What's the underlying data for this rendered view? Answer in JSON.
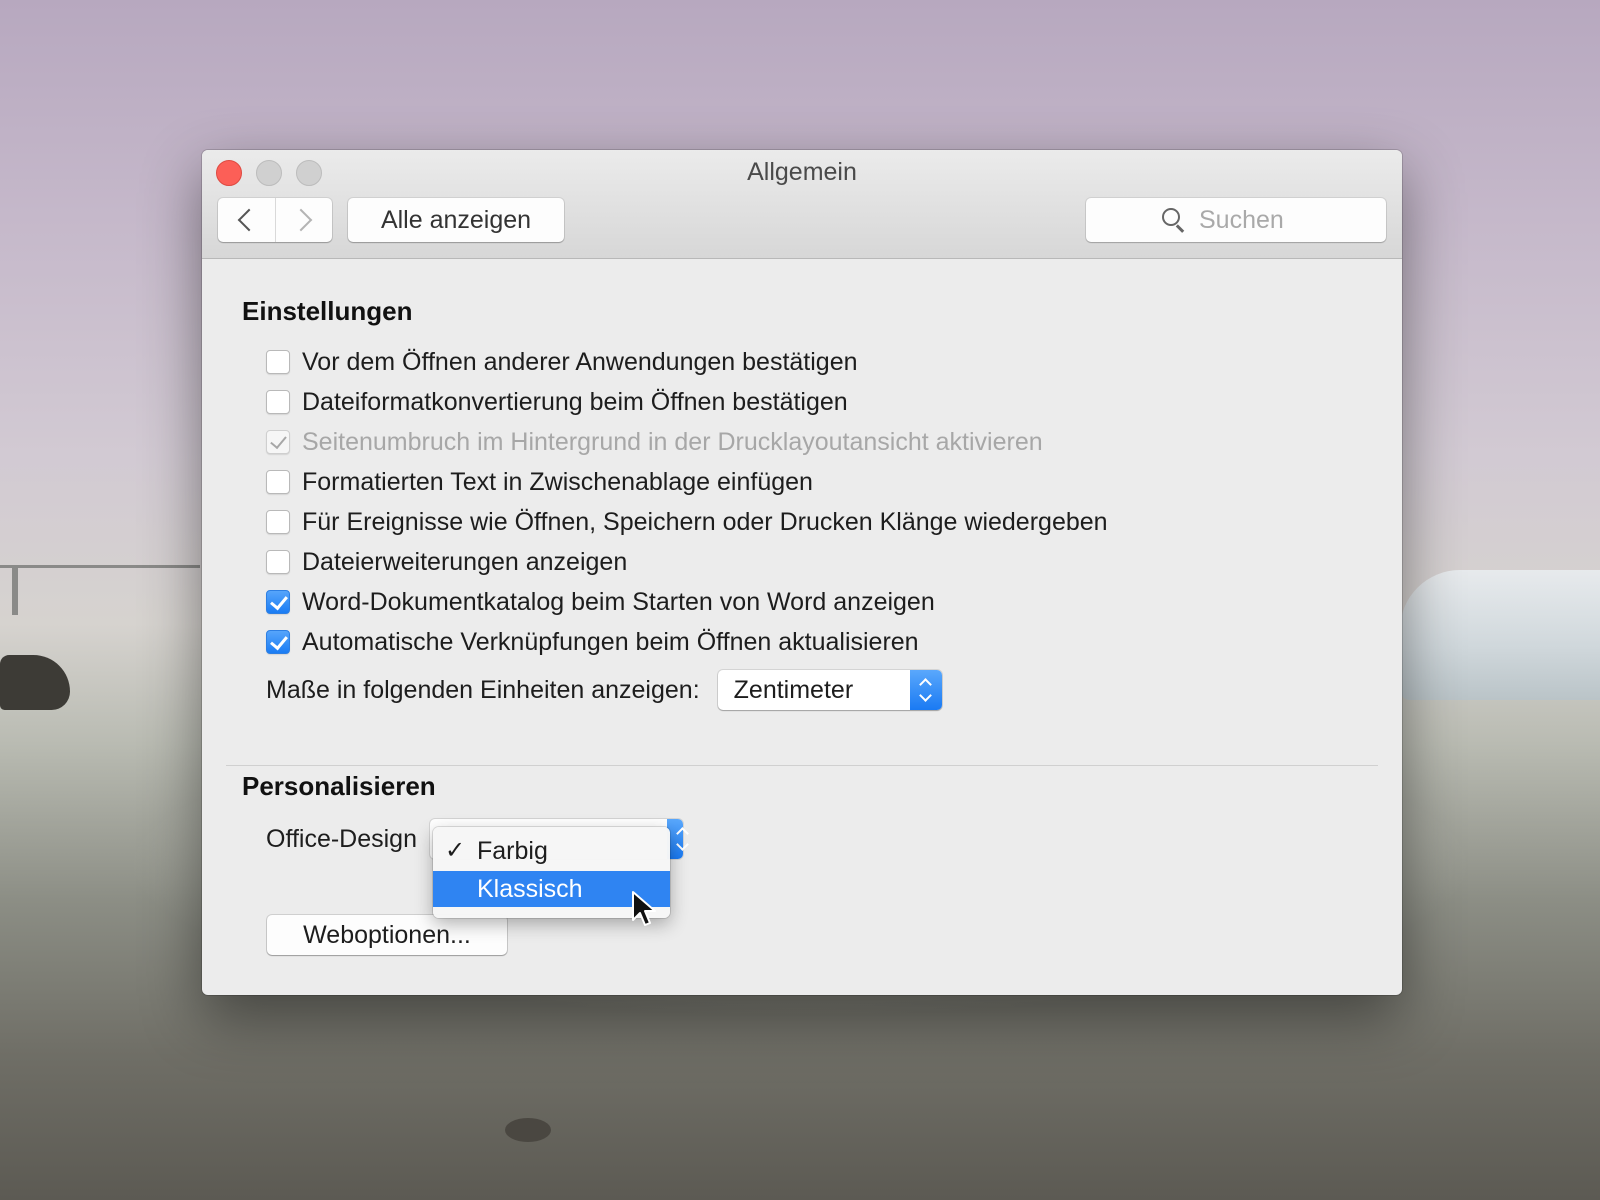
{
  "window": {
    "title": "Allgemein"
  },
  "toolbar": {
    "show_all_label": "Alle anzeigen",
    "search_placeholder": "Suchen"
  },
  "settings": {
    "heading": "Einstellungen",
    "checkboxes": [
      {
        "label": "Vor dem Öffnen anderer Anwendungen bestätigen",
        "checked": false,
        "enabled": true
      },
      {
        "label": "Dateiformatkonvertierung beim Öffnen bestätigen",
        "checked": false,
        "enabled": true
      },
      {
        "label": "Seitenumbruch im Hintergrund in der Drucklayoutansicht aktivieren",
        "checked": true,
        "enabled": false
      },
      {
        "label": "Formatierten Text in Zwischenablage einfügen",
        "checked": false,
        "enabled": true
      },
      {
        "label": "Für Ereignisse wie Öffnen, Speichern oder Drucken Klänge wiedergeben",
        "checked": false,
        "enabled": true
      },
      {
        "label": "Dateierweiterungen anzeigen",
        "checked": false,
        "enabled": true
      },
      {
        "label": "Word-Dokumentkatalog beim Starten von Word anzeigen",
        "checked": true,
        "enabled": true
      },
      {
        "label": "Automatische Verknüpfungen beim Öffnen aktualisieren",
        "checked": true,
        "enabled": true
      }
    ],
    "units_label": "Maße in folgenden Einheiten anzeigen:",
    "units_value": "Zentimeter"
  },
  "personalize": {
    "heading": "Personalisieren",
    "design_label": "Office-Design",
    "menu_items": [
      {
        "label": "Farbig",
        "checked": true,
        "highlighted": false
      },
      {
        "label": "Klassisch",
        "checked": false,
        "highlighted": true
      }
    ],
    "checkmark_glyph": "✓",
    "web_options_label": "Weboptionen..."
  },
  "colors": {
    "accent": "#2f84f2",
    "close_button": "#fc5f57"
  }
}
